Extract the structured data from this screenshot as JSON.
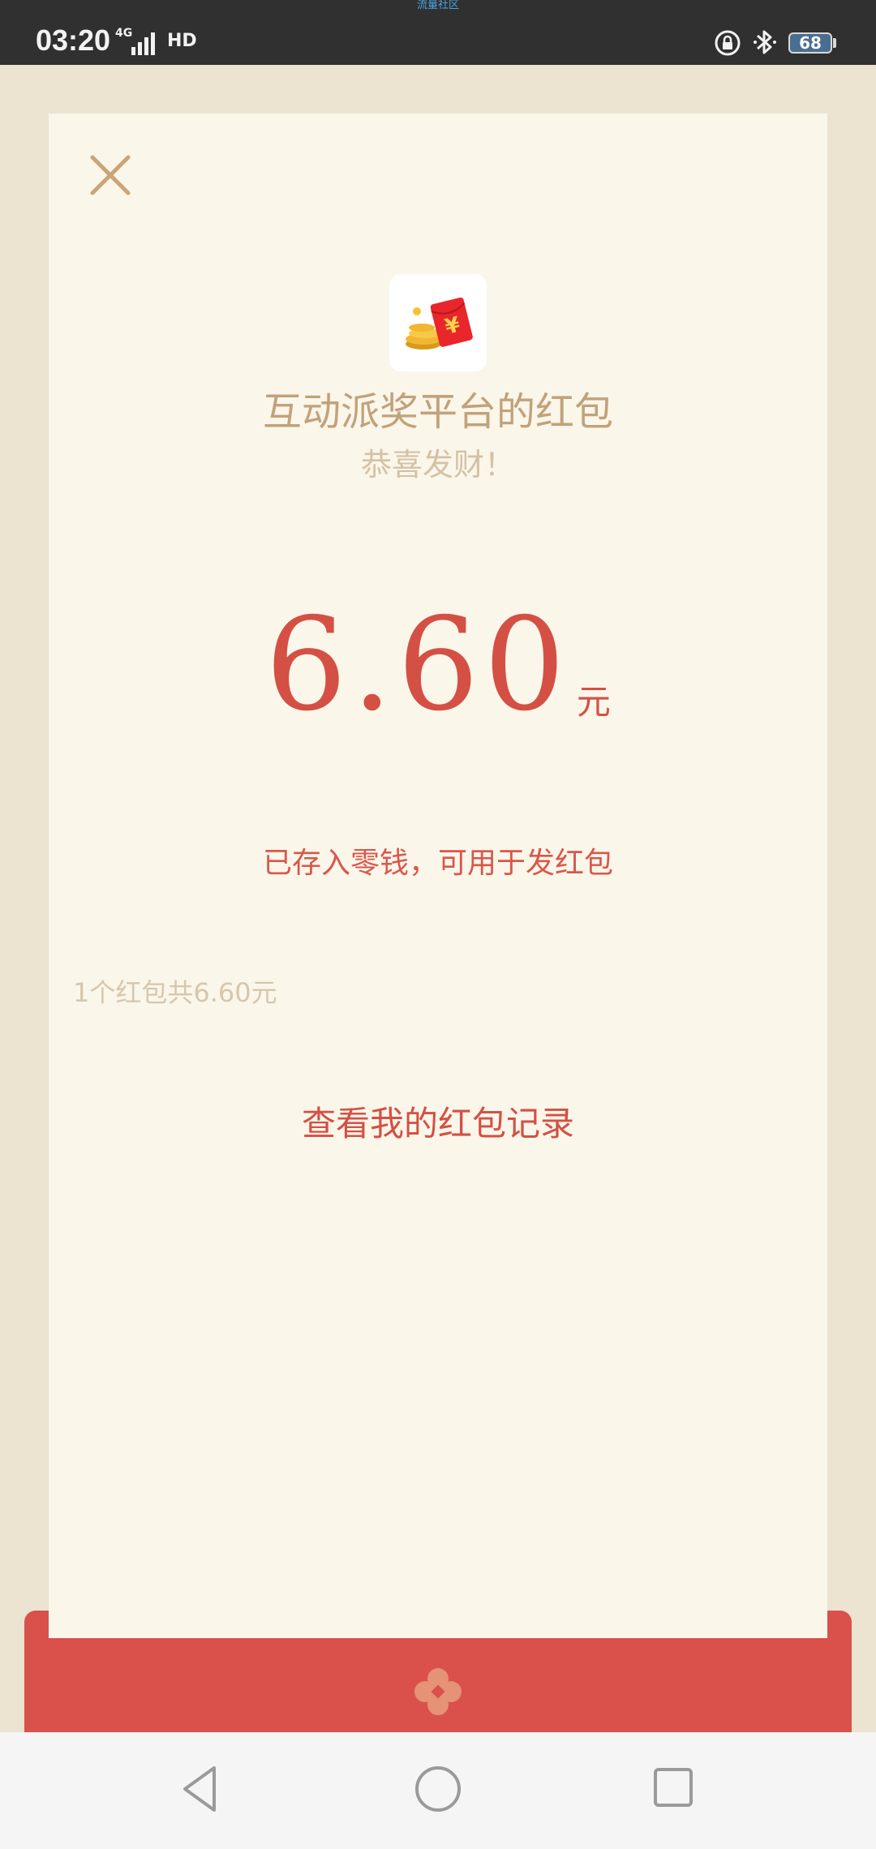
{
  "status_bar": {
    "top_label": "流量社区",
    "time": "03:20",
    "network": "4G",
    "hd_label": "HD",
    "battery": "68"
  },
  "red_packet": {
    "sender_title": "互动派奖平台的红包",
    "blessing": "恭喜发财！",
    "amount": "6.60",
    "unit": "元",
    "saved_note": "已存入零钱，可用于发红包",
    "summary": "1个红包共6.60元",
    "records_link": "查看我的红包记录"
  },
  "colors": {
    "accent_red": "#d45044",
    "gold_text": "#c2a27a",
    "card_bg": "#faf6ea",
    "page_bg": "#ece3d0"
  },
  "icons": [
    "close-icon",
    "red-packet-app-icon",
    "signal-icon",
    "hd-call-icon",
    "rotation-lock-icon",
    "bluetooth-icon",
    "battery-icon",
    "flower-icon",
    "back-icon",
    "home-icon",
    "recent-apps-icon"
  ]
}
